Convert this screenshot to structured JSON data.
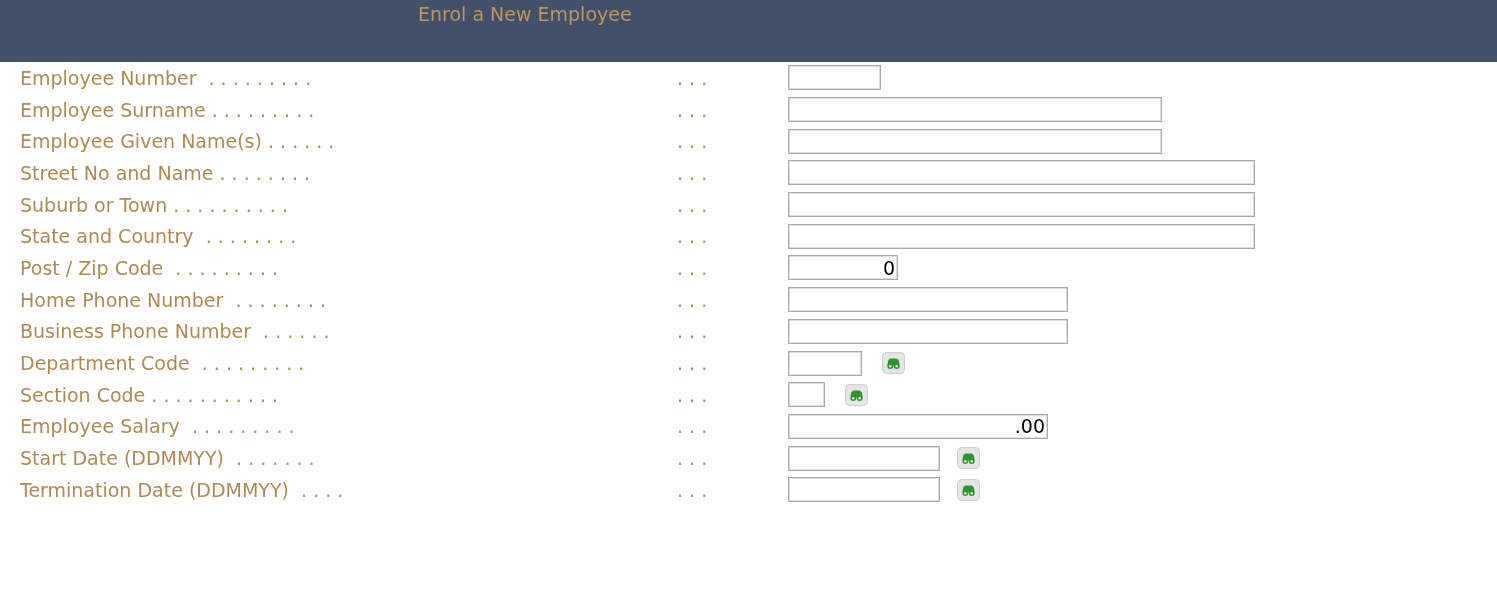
{
  "header": {
    "title": "Enrol a New Employee"
  },
  "form": {
    "rows": [
      {
        "label": "Employee Number  . . . . . . . . .",
        "leader": ". . .",
        "lookup": false
      },
      {
        "label": "Employee Surname . . . . . . . . .",
        "leader": ". . .",
        "lookup": false
      },
      {
        "label": "Employee Given Name(s) . . . . . .",
        "leader": ". . .",
        "lookup": false
      },
      {
        "label": "Street No and Name . . . . . . . .",
        "leader": ". . .",
        "lookup": false
      },
      {
        "label": "Suburb or Town . . . . . . . . . .",
        "leader": ". . .",
        "lookup": false
      },
      {
        "label": "State and Country  . . . . . . . .",
        "leader": ". . .",
        "lookup": false
      },
      {
        "label": "Post / Zip Code  . . . . . . . . .",
        "leader": ". . .",
        "value": "0",
        "lookup": false
      },
      {
        "label": "Home Phone Number  . . . . . . . .",
        "leader": ". . .",
        "lookup": false
      },
      {
        "label": "Business Phone Number  . . . . . .",
        "leader": ". . .",
        "lookup": false
      },
      {
        "label": "Department Code  . . . . . . . . .",
        "leader": ". . .",
        "lookup": true
      },
      {
        "label": "Section Code . . . . . . . . . . .",
        "leader": ". . .",
        "lookup": true
      },
      {
        "label": "Employee Salary  . . . . . . . . .",
        "leader": ". . .",
        "value": ".00",
        "lookup": false
      },
      {
        "label": "Start Date (DDMMYY)  . . . . . . .",
        "leader": ". . .",
        "lookup": true
      },
      {
        "label": "Termination Date (DDMMYY)  . . . .",
        "leader": ". . .",
        "lookup": true
      }
    ]
  }
}
